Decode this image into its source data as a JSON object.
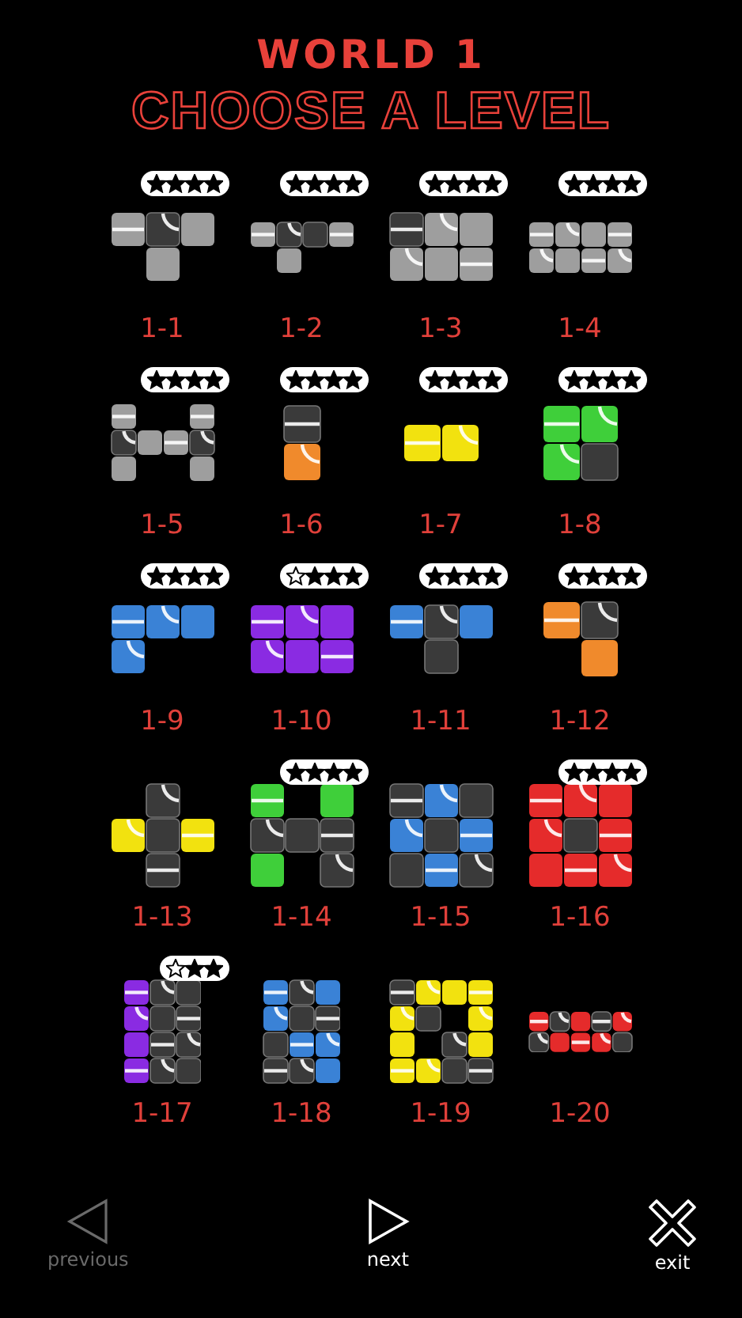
{
  "header": {
    "world": "WORLD 1",
    "title": "CHOOSE A LEVEL"
  },
  "levels": [
    {
      "label": "1-1",
      "color": "#9e9e9e",
      "stars": 4,
      "kind": "large"
    },
    {
      "label": "1-2",
      "color": "#9e9e9e",
      "stars": 4,
      "kind": "large"
    },
    {
      "label": "1-3",
      "color": "#9e9e9e",
      "stars": 4,
      "kind": "large"
    },
    {
      "label": "1-4",
      "color": "#9e9e9e",
      "stars": 4,
      "kind": "large"
    },
    {
      "label": "1-5",
      "color": "#9e9e9e",
      "stars": 4,
      "kind": "large"
    },
    {
      "label": "1-6",
      "color": "#f08a2c",
      "stars": 4,
      "kind": "large"
    },
    {
      "label": "1-7",
      "color": "#f2e20f",
      "stars": 4,
      "kind": "large"
    },
    {
      "label": "1-8",
      "color": "#3fcf3a",
      "stars": 4,
      "kind": "large"
    },
    {
      "label": "1-9",
      "color": "#3a82d6",
      "stars": 4,
      "kind": "large"
    },
    {
      "label": "1-10",
      "color": "#8a2be2",
      "stars": 3,
      "kind": "large"
    },
    {
      "label": "1-11",
      "color": "#3a82d6",
      "stars": 4,
      "kind": "large"
    },
    {
      "label": "1-12",
      "color": "#f08a2c",
      "stars": 4,
      "kind": "large"
    },
    {
      "label": "1-13",
      "color": "#f2e20f"
    },
    {
      "label": "1-14",
      "color": "#3fcf3a",
      "stars": 4,
      "kind": "large"
    },
    {
      "label": "1-15",
      "color": "#3a82d6"
    },
    {
      "label": "1-16",
      "color": "#e52b2b",
      "stars": 4,
      "kind": "large"
    },
    {
      "label": "1-17",
      "color": "#8a2be2",
      "stars": 2,
      "kind": "small"
    },
    {
      "label": "1-18",
      "color": "#3a82d6"
    },
    {
      "label": "1-19",
      "color": "#f2e20f"
    },
    {
      "label": "1-20",
      "color": "#e52b2b"
    }
  ],
  "nav": [
    {
      "kind": "previous",
      "label": "previous",
      "disabled": true
    },
    {
      "kind": "next",
      "label": "next",
      "disabled": false
    },
    {
      "kind": "exit",
      "label": "exit",
      "disabled": false
    }
  ]
}
